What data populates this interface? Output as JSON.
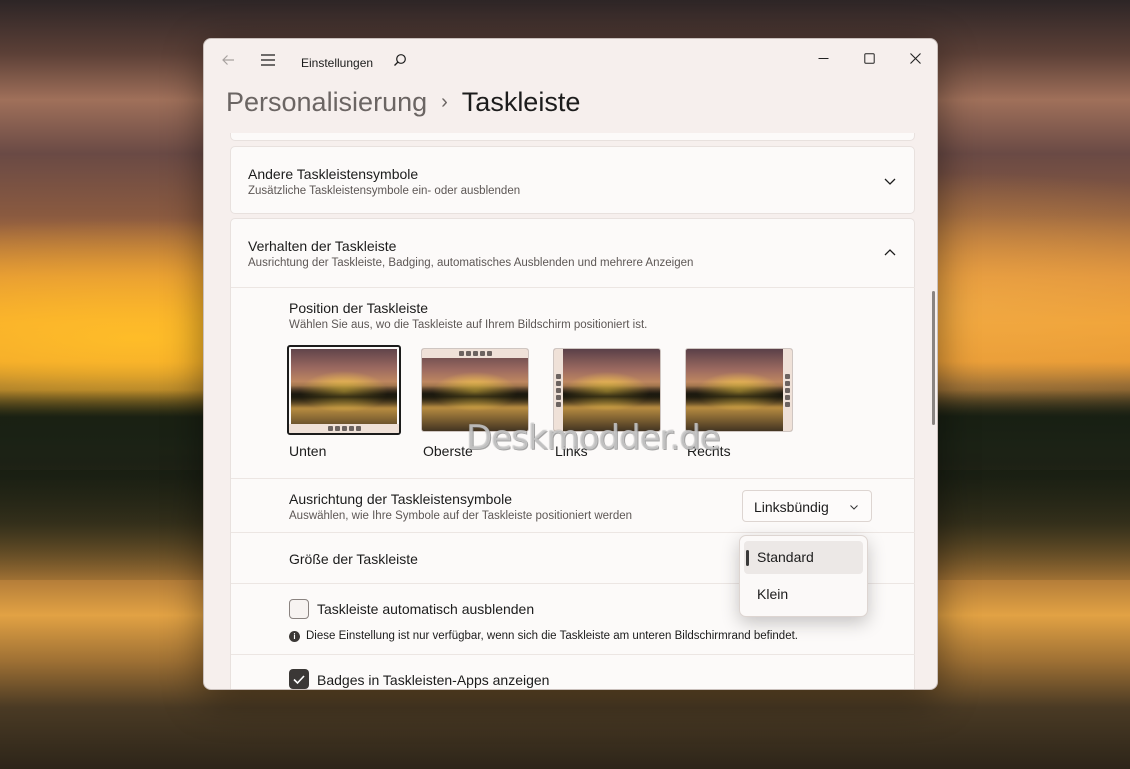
{
  "window": {
    "app_title": "Einstellungen",
    "breadcrumb_parent": "Personalisierung",
    "breadcrumb_separator": "›",
    "breadcrumb_current": "Taskleiste"
  },
  "sections": {
    "other_icons": {
      "title": "Andere Taskleistensymbole",
      "subtitle": "Zusätzliche Taskleistensymbole ein- oder ausblenden"
    },
    "behavior": {
      "title": "Verhalten der Taskleiste",
      "subtitle": "Ausrichtung der Taskleiste, Badging, automatisches Ausblenden und mehrere Anzeigen"
    }
  },
  "position": {
    "title": "Position der Taskleiste",
    "subtitle": "Wählen Sie aus, wo die Taskleiste auf Ihrem Bildschirm positioniert ist.",
    "options": [
      {
        "label": "Unten",
        "selected": true
      },
      {
        "label": "Oberste",
        "selected": false
      },
      {
        "label": "Links",
        "selected": false
      },
      {
        "label": "Rechts",
        "selected": false
      }
    ]
  },
  "alignment": {
    "title": "Ausrichtung der Taskleistensymbole",
    "subtitle": "Auswählen, wie Ihre Symbole auf der Taskleiste positioniert werden",
    "value": "Linksbündig"
  },
  "size": {
    "title": "Größe der Taskleiste",
    "options": [
      "Standard",
      "Klein"
    ],
    "selected": "Standard"
  },
  "autohide": {
    "label": "Taskleiste automatisch ausblenden",
    "checked": false,
    "info": "Diese Einstellung ist nur verfügbar, wenn sich die Taskleiste am unteren Bildschirmrand befindet."
  },
  "badges": {
    "label": "Badges in Taskleisten-Apps anzeigen",
    "checked": true
  },
  "watermark": "Deskmodder.de",
  "icons": {
    "back": "back-arrow-icon",
    "menu": "hamburger-menu-icon",
    "search": "search-icon",
    "minimize": "minimize-icon",
    "maximize": "maximize-icon",
    "close": "close-icon",
    "expand": "chevron-down-icon",
    "collapse": "chevron-up-icon",
    "info": "info-icon",
    "check": "checkmark-icon"
  }
}
